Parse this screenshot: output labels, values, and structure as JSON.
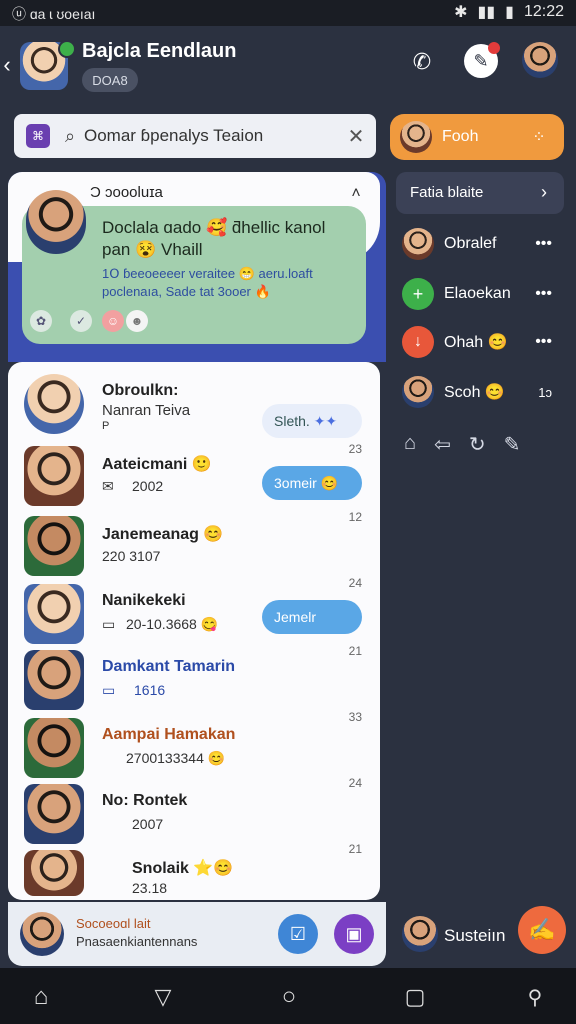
{
  "statusbar": {
    "left_text": "ⓤ ɑa ɩ ʊoeıaı",
    "time": "12:22"
  },
  "header": {
    "title": "Bajcla Eendlaun",
    "badge": "DOA8"
  },
  "search": {
    "placeholder": "Oomar ɓpenalys Teaion"
  },
  "sidecard": {
    "label": "Fooh"
  },
  "panel": {
    "section_label": "Ɔ ɔoooluɪa",
    "message_line1": "Doclala ɑado 🥰 ƌhellic kanol",
    "message_line2": "pan 😵 Vhaill",
    "message_line3": "1𝖮 ɓeeoeeeer veraitee 😁 aeru.loaft",
    "message_line4": "poclenaıa, Sade tat 3ooer 🔥"
  },
  "list": [
    {
      "name": "Obroulkn:",
      "sub": "Nanran Teiva",
      "sub2": "P",
      "time": "",
      "button": "Sleth."
    },
    {
      "name": "Aateicmani 🙂",
      "sub": "2002",
      "sub_icon": "envelope-icon",
      "time": "23",
      "button": "3omeir 😊"
    },
    {
      "name": "Janemeanag 😊",
      "sub": "220 3107",
      "time": "12",
      "button": ""
    },
    {
      "name": "Nanikekeki",
      "sub": "20-10.3668 😋",
      "sub_icon": "card-icon",
      "time": "24",
      "button": "Jemelr"
    },
    {
      "name": "Damkant Tamarin",
      "sub": "1616",
      "sub_icon": "card-icon",
      "time": "21",
      "button": ""
    },
    {
      "name": "Aampai Hamakan",
      "sub": "2700133344 😊",
      "time": "33",
      "button": ""
    },
    {
      "name": "No: Rontek",
      "sub": "2007",
      "time": "24",
      "button": ""
    },
    {
      "name": "Snolaik ⭐😊",
      "sub": "23.18",
      "time": "21",
      "button": ""
    }
  ],
  "bottom": {
    "title": "Socoeoɑl lait",
    "subtitle": "Pnasaenkiantennans"
  },
  "sidepanel": {
    "header": "Fatia blaite",
    "items": [
      {
        "label": "Obralef"
      },
      {
        "label": "Elaoekan"
      },
      {
        "label": "Ohah 😊"
      },
      {
        "label": "Scoh 😊",
        "meta": "1ɔ"
      }
    ],
    "footer_label": "Susteiın"
  },
  "colors": {
    "accent_orange": "#f09a3e",
    "accent_blue": "#5aa7e6",
    "panel_blue": "#3b4fb0",
    "card_green": "#a3cfae"
  }
}
